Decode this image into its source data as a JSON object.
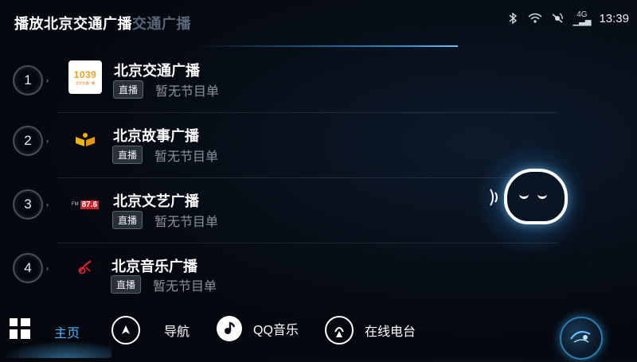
{
  "header": {
    "title_prefix": "播放",
    "title_station": "北京交通广播",
    "title_ghost": "交通广播"
  },
  "status": {
    "network": "4G",
    "time": "13:39",
    "icons": [
      "bluetooth-icon",
      "wifi-icon",
      "signal-icon",
      "network-4g-icon"
    ]
  },
  "stations": [
    {
      "number": "1",
      "name": "北京交通广播",
      "live_label": "直播",
      "schedule": "暂无节目单",
      "logo_text": "1039",
      "logo_subtext": "北京交通广播"
    },
    {
      "number": "2",
      "name": "北京故事广播",
      "live_label": "直播",
      "schedule": "暂无节目单",
      "logo_text": "",
      "logo_subtext": ""
    },
    {
      "number": "3",
      "name": "北京文艺广播",
      "live_label": "直播",
      "schedule": "暂无节目单",
      "logo_text": "87.6",
      "logo_subtext": "FM"
    },
    {
      "number": "4",
      "name": "北京音乐广播",
      "live_label": "直播",
      "schedule": "暂无节目单",
      "logo_text": "",
      "logo_subtext": ""
    }
  ],
  "bottom_nav": {
    "items": [
      {
        "label": "主页",
        "icon": "home-icon",
        "active": true
      },
      {
        "label": "导航",
        "icon": "navigation-icon",
        "active": false
      },
      {
        "label": "QQ音乐",
        "icon": "qq-music-icon",
        "active": false
      },
      {
        "label": "在线电台",
        "icon": "online-radio-icon",
        "active": false
      }
    ]
  },
  "colors": {
    "accent": "#4ab8ff",
    "background": "#050a12",
    "badge_bg": "#2a3038",
    "muted_text": "#8a939d"
  }
}
